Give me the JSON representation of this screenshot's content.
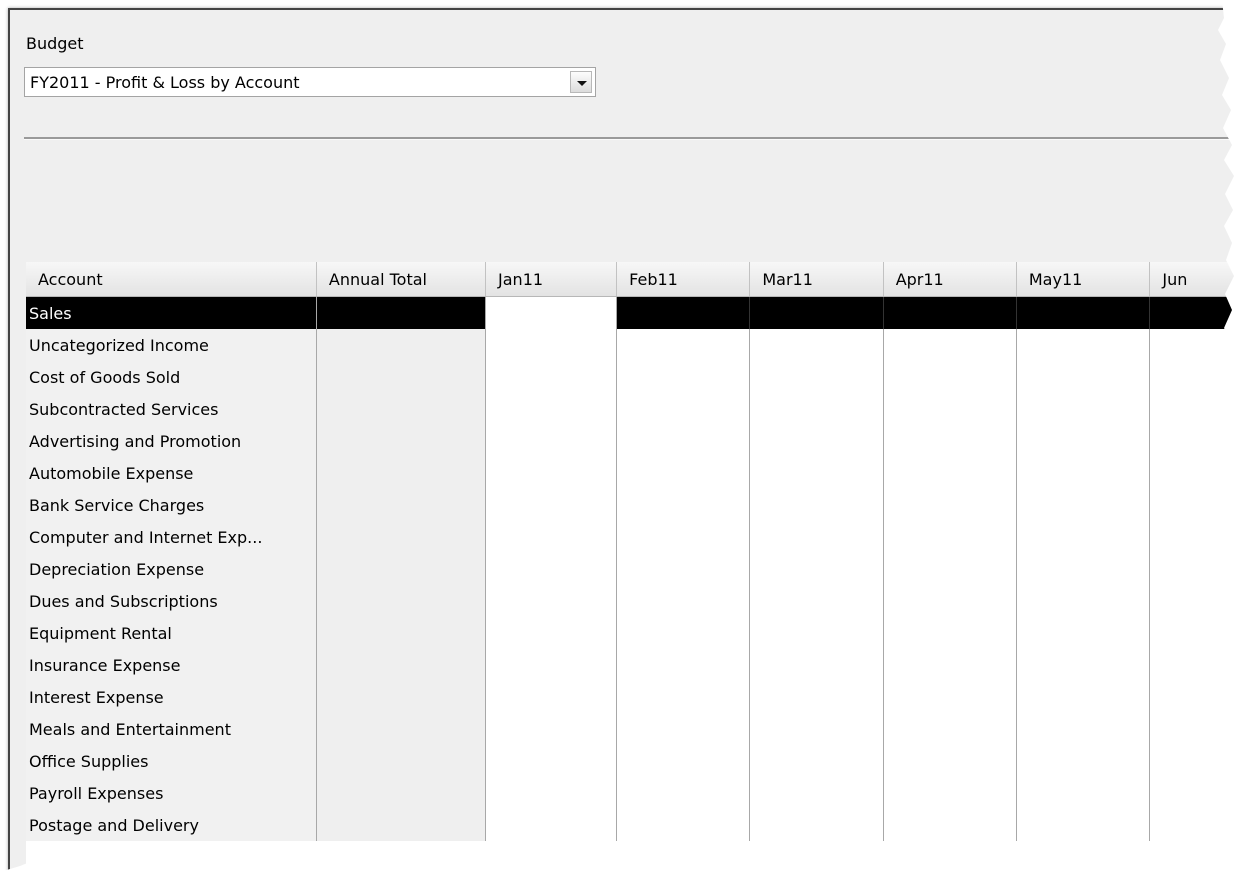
{
  "budget": {
    "label": "Budget",
    "selected": "FY2011 - Profit & Loss by Account"
  },
  "grid": {
    "columns": [
      "Account",
      "Annual Total",
      "Jan11",
      "Feb11",
      "Mar11",
      "Apr11",
      "May11",
      "Jun"
    ],
    "selected_row": 0,
    "rows": [
      "Sales",
      "Uncategorized Income",
      "Cost of Goods Sold",
      "Subcontracted Services",
      "Advertising and Promotion",
      "Automobile Expense",
      "Bank Service Charges",
      "Computer and Internet Exp...",
      "Depreciation Expense",
      "Dues and Subscriptions",
      "Equipment Rental",
      "Insurance Expense",
      "Interest Expense",
      "Meals and Entertainment",
      "Office Supplies",
      "Payroll Expenses",
      "Postage and Delivery"
    ]
  }
}
